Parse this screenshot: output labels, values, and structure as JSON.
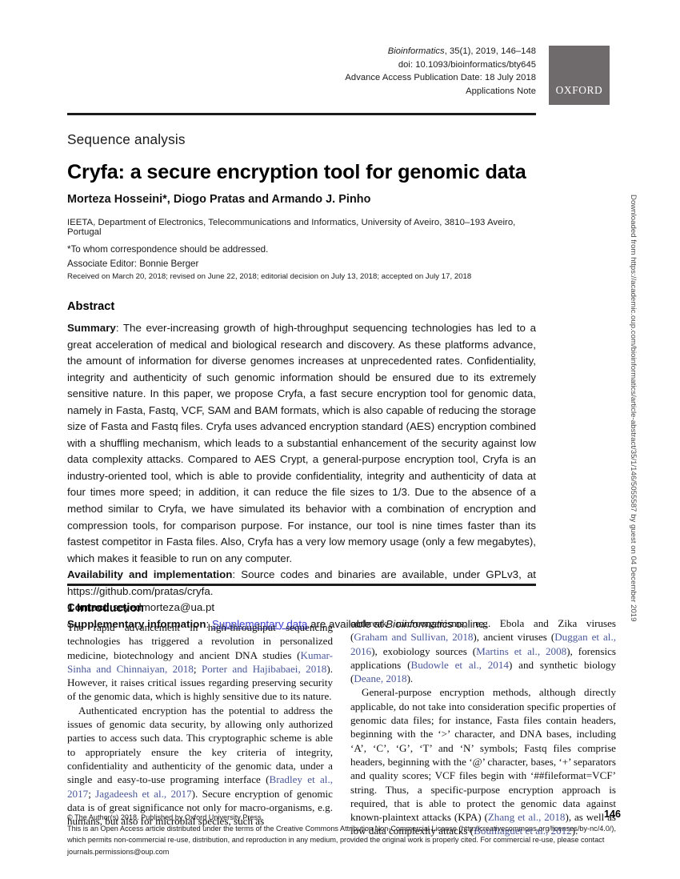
{
  "masthead": {
    "journal_name": "Bioinformatics",
    "citation_rest": ", 35(1), 2019, 146–148",
    "doi": "doi: 10.1093/bioinformatics/bty645",
    "advance_access": "Advance Access Publication Date: 18 July 2018",
    "article_type": "Applications Note",
    "publisher_logo_text": "OXFORD"
  },
  "header": {
    "section_kicker": "Sequence analysis",
    "title": "Cryfa: a secure encryption tool for genomic data",
    "authors": "Morteza Hosseini*, Diogo Pratas and Armando J. Pinho",
    "affiliation": "IEETA, Department of Electronics, Telecommunications and Informatics, University of Aveiro, 3810–193 Aveiro, Portugal",
    "correspondence": "*To whom correspondence should be addressed.",
    "associate_editor": "Associate Editor: Bonnie Berger",
    "history": "Received on March 20, 2018; revised on June 22, 2018; editorial decision on July 13, 2018; accepted on July 17, 2018"
  },
  "abstract": {
    "heading": "Abstract",
    "summary_label": "Summary",
    "summary_text": ": The ever-increasing growth of high-throughput sequencing technologies has led to a great acceleration of medical and biological research and discovery. As these platforms advance, the amount of information for diverse genomes increases at unprecedented rates. Confidentiality, integrity and authenticity of such genomic information should be ensured due to its extremely sensitive nature. In this paper, we propose Cryfa, a fast secure encryption tool for genomic data, namely in Fasta, Fastq, VCF, SAM and BAM formats, which is also capable of reducing the storage size of Fasta and Fastq files. Cryfa uses advanced encryption standard (AES) encryption combined with a shuffling mechanism, which leads to a substantial enhancement of the security against low data complexity attacks. Compared to AES Crypt, a general-purpose encryption tool, Cryfa is an industry-oriented tool, which is able to provide confidentiality, integrity and authenticity of data at four times more speed; in addition, it can reduce the file sizes to 1/3. Due to the absence of a method similar to Cryfa, we have simulated its behavior with a combination of encryption and compression tools, for comparison purpose. For instance, our tool is nine times faster than its fastest competitor in Fasta files. Also, Cryfa has a very low memory usage (only a few megabytes), which makes it feasible to run on any computer.",
    "availability_label": "Availability and implementation",
    "availability_text": ": Source codes and binaries are available, under GPLv3, at https://github.com/pratas/cryfa.",
    "contact_label": "Contact",
    "contact_text": ": seyedmorteza@ua.pt",
    "supplementary_label": "Supplementary information",
    "supplementary_prefix": ": ",
    "supplementary_link": "Supplementary data",
    "supplementary_mid": " are available at ",
    "supplementary_journal": "Bioinformatics",
    "supplementary_suffix": " online."
  },
  "body": {
    "intro_heading": "1 Introduction",
    "left_p1_a": "The rapid advancement in high-throughput sequencing technologies has triggered a revolution in personalized medicine, biotechnology and ancient DNA studies (",
    "left_p1_cite1": "Kumar-Sinha and Chinnaiyan, 2018",
    "left_p1_b": "; ",
    "left_p1_cite2": "Porter and Hajibabaei, 2018",
    "left_p1_c": "). However, it raises critical issues regarding preserving security of the genomic data, which is highly sensitive due to its nature.",
    "left_p2_a": "Authenticated encryption has the potential to address the issues of genomic data security, by allowing only authorized parties to access such data. This cryptographic scheme is able to appropriately ensure the key criteria of integrity, confidentiality and authenticity of the genomic data, under a single and easy-to-use programing interface (",
    "left_p2_cite1": "Bradley et al., 2017",
    "left_p2_b": "; ",
    "left_p2_cite2": "Jagadeesh et al., 2017",
    "left_p2_c": "). Secure encryption of genomic data is of great significance not only for macro-organisms, e.g. humans, but also for microbial species, such as",
    "right_p1_a": "outbreak microorganisms, e.g. Ebola and Zika viruses (",
    "right_p1_cite1": "Graham and Sullivan, 2018",
    "right_p1_b": "), ancient viruses (",
    "right_p1_cite2": "Duggan et al., 2016",
    "right_p1_c": "), exobiology sources (",
    "right_p1_cite3": "Martins et al., 2008",
    "right_p1_d": "), forensics applications (",
    "right_p1_cite4": "Budowle et al., 2014",
    "right_p1_e": ") and synthetic biology (",
    "right_p1_cite5": "Deane, 2018",
    "right_p1_f": ").",
    "right_p2_a": "General-purpose encryption methods, although directly applicable, do not take into consideration specific properties of genomic data files; for instance, Fasta files contain headers, beginning with the ‘>’ character, and DNA bases, including ‘A’, ‘C’, ‘G’, ‘T’ and ‘N’ symbols; Fastq files comprise headers, beginning with the ‘@’ character, bases, ‘+’ separators and quality scores; VCF files begin with ‘##fileformat=VCF’ string. Thus, a specific-purpose encryption approach is required, that is able to protect the genomic data against known-plaintext attacks (KPA) (",
    "right_p2_cite1": "Zhang et al., 2018",
    "right_p2_b": "), as well as low data complexity attacks (",
    "right_p2_cite2": "Bouillaguet et al., 2012",
    "right_p2_c": ")."
  },
  "footer": {
    "copyright": "© The Author(s) 2018. Published by Oxford University Press.",
    "license": "This is an Open Access article distributed under the terms of the Creative Commons Attribution Non-Commercial License (http://creativecommons.org/licenses/by-nc/4.0/), which permits non-commercial re-use, distribution, and reproduction in any medium, provided the original work is properly cited. For commercial re-use, please contact journals.permissions@oup.com",
    "page_number": "146"
  },
  "side_note": {
    "text": "Downloaded from https://academic.oup.com/bioinformatics/article-abstract/35/1/146/5055587 by guest on 04 December 2019"
  },
  "colors": {
    "citation_link": "#4a5899",
    "supplementary_link": "#3a3ad0",
    "logo_background": "#6f6b6c",
    "rule": "#1c1c1c"
  }
}
